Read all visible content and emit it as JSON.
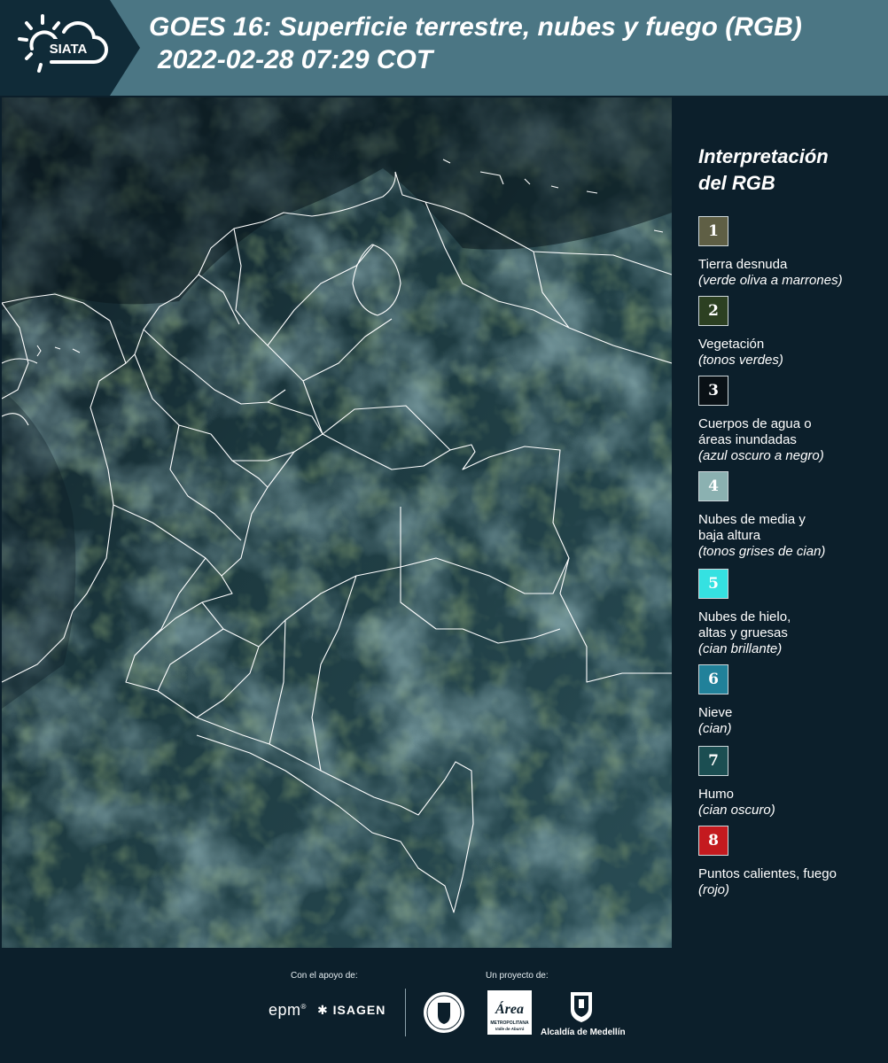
{
  "header": {
    "logo_text": "SIATA",
    "title_line1": "GOES 16: Superficie terrestre, nubes y fuego (RGB)",
    "title_line2": "2022-02-28 07:29 COT"
  },
  "legend": {
    "title_line1": "Interpretación",
    "title_line2": "del RGB",
    "items": [
      {
        "number": "1",
        "color": "#5f5f45",
        "label": [
          "Tierra desnuda"
        ],
        "sub": "verde oliva a marrones"
      },
      {
        "number": "2",
        "color": "#2c4022",
        "label": [
          "Vegetación"
        ],
        "sub": "tonos verdes"
      },
      {
        "number": "3",
        "color": "#0a1116",
        "label": [
          "Cuerpos de agua o",
          "áreas inundadas"
        ],
        "sub": "azul oscuro a negro"
      },
      {
        "number": "4",
        "color": "#8bb1b1",
        "label": [
          "Nubes de media y",
          "baja altura"
        ],
        "sub": "tonos grises de cian"
      },
      {
        "number": "5",
        "color": "#35e1e1",
        "label": [
          "Nubes de hielo,",
          "altas y gruesas"
        ],
        "sub": "cian brillante"
      },
      {
        "number": "6",
        "color": "#21819a",
        "label": [
          "Nieve"
        ],
        "sub": "cian"
      },
      {
        "number": "7",
        "color": "#1b4e52",
        "label": [
          "Humo"
        ],
        "sub": "cian oscuro"
      },
      {
        "number": "8",
        "color": "#c41a1f",
        "label": [
          "Puntos calientes, fuego"
        ],
        "sub": "rojo"
      }
    ]
  },
  "footer": {
    "support_caption": "Con el apoyo de:",
    "project_caption": "Un proyecto de:",
    "epm": "epm",
    "isagen": "ISAGEN",
    "area_metro": "Área",
    "area_metro_sub": "METROPOLITANA",
    "area_metro_sub2": "Valle de Aburrá",
    "alcaldia": "Alcaldía de Medellín"
  },
  "colors": {
    "header_bg": "#4b7684",
    "panel_bg": "#0c1f2b",
    "border_lines": "#ffffff"
  }
}
